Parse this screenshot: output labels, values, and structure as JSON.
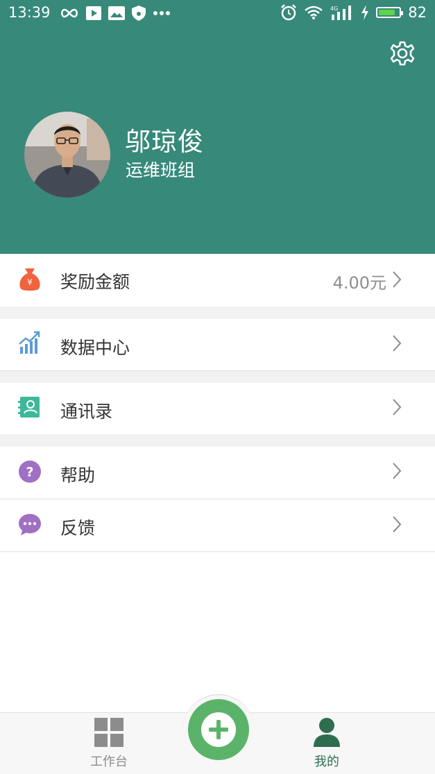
{
  "status_bar": {
    "time": "13:39",
    "battery_level": "82",
    "battery_fraction": 0.82,
    "left_icons": [
      "infinity-icon",
      "play-icon",
      "image-icon",
      "shield-icon",
      "more-dots-icon"
    ],
    "right_icons": [
      "alarm-icon",
      "wifi-icon",
      "signal-icon",
      "charging-icon",
      "battery-icon"
    ]
  },
  "profile": {
    "name": "邬琼俊",
    "team": "运维班组"
  },
  "menu": {
    "reward": {
      "label": "奖励金额",
      "value": "4.00元",
      "icon": "money-bag-icon"
    },
    "data_center": {
      "label": "数据中心",
      "icon": "chart-icon"
    },
    "contacts": {
      "label": "通讯录",
      "icon": "contact-book-icon"
    },
    "help": {
      "label": "帮助",
      "icon": "question-icon"
    },
    "feedback": {
      "label": "反馈",
      "icon": "chat-bubble-icon"
    }
  },
  "bottom_nav": {
    "workbench_label": "工作台",
    "mine_label": "我的",
    "add_icon": "plus-icon"
  },
  "colors": {
    "header": "#37897a",
    "active_tab": "#2e6e4f",
    "fab": "#5bb36a",
    "reward_icon": "#f1623d",
    "data_icon": "#5b9bd6",
    "contacts_icon": "#3fb89a",
    "help_icon": "#a070c4",
    "feedback_icon": "#a070c4"
  }
}
